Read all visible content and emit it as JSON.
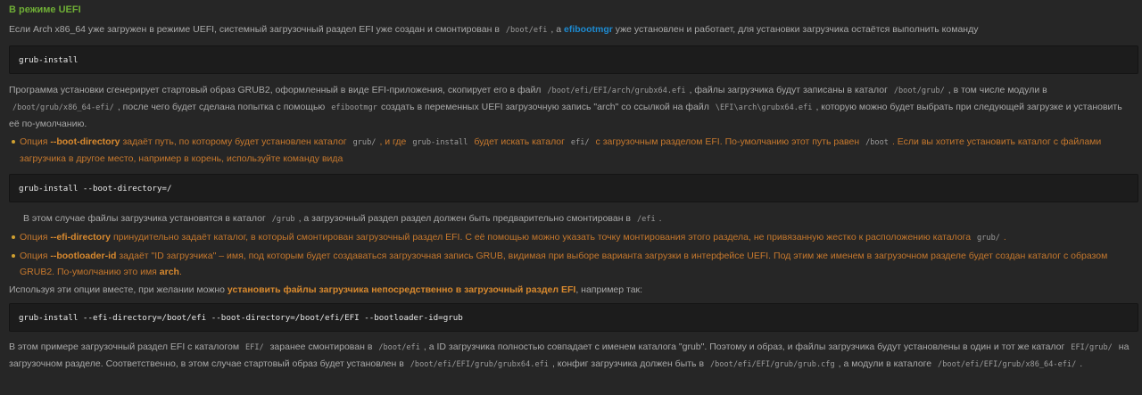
{
  "section_title": "В режиме UEFI",
  "p1": {
    "t1": "Если Arch x86_64 уже загружен в режиме UEFI, системный загрузочный раздел EFI уже создан и смонтирован в",
    "c1": "/boot/efi",
    "t2": ", а",
    "link": "efibootmgr",
    "t3": "уже установлен и работает, для установки загрузчика остаётся выполнить команду"
  },
  "code1": "grub-install",
  "p2": {
    "t1": "Программа установки сгенерирует стартовый образ GRUB2, оформленный в виде EFI-приложения, скопирует его в файл",
    "c1": "/boot/efi/EFI/arch/grubx64.efi",
    "t2": ", файлы загрузчика будут записаны в каталог",
    "c2": "/boot/grub/",
    "t3": ", в том числе модули в",
    "c3": "/boot/grub/x86_64-efi/",
    "t4": ", после чего будет сделана попытка с помощью",
    "c4": "efibootmgr",
    "t5": "создать в переменных UEFI загрузочную запись \"arch\" со ссылкой на файл",
    "c5": "\\EFI\\arch\\grubx64.efi",
    "t6": ", которую можно будет выбрать при следующей загрузке и установить её по-умолчанию."
  },
  "bullet1": {
    "t1": "Опция",
    "b1": "--boot-directory",
    "t2": "задаёт путь, по которому будет установлен каталог",
    "c1": "grub/",
    "t3": ", и где",
    "c2": "grub-install",
    "t4": "будет искать каталог",
    "c3": "efi/",
    "t5": "с загрузочным разделом EFI. По-умолчанию этот путь равен",
    "c4": "/boot",
    "t6": ". Если вы хотите установить каталог с файлами загрузчика в другое место, например в корень, используйте команду вида"
  },
  "code2": "grub-install --boot-directory=/",
  "p3": {
    "t1": "В этом случае файлы загрузчика установятся в каталог",
    "c1": "/grub",
    "t2": ", а загрузочный раздел раздел должен быть предварительно смонтирован в",
    "c2": "/efi",
    "t3": "."
  },
  "bullet2": {
    "t1": "Опция",
    "b1": "--efi-directory",
    "t2": "принудительно задаёт каталог, в который смонтирован загрузочный раздел EFI. С её помощью можно указать точку монтирования этого раздела, не привязанную жестко к расположению каталога",
    "c1": "grub/",
    "t3": "."
  },
  "bullet3": {
    "t1": "Опция",
    "b1": "--bootloader-id",
    "t2": "задаёт \"ID загрузчика\" – имя, под которым будет создаваться загрузочная запись GRUB, видимая при выборе варианта загрузки в интерфейсе UEFI. Под этим же именем в загрузочном разделе будет создан каталог с образом GRUB2. По-умолчанию это имя",
    "b2": "arch",
    "t3": "."
  },
  "p4": {
    "t1": "Используя эти опции вместе, при желании можно",
    "b1": "установить файлы загрузчика непосредственно в загрузочный раздел EFI",
    "t2": ", например так:"
  },
  "code3": "grub-install --efi-directory=/boot/efi --boot-directory=/boot/efi/EFI --bootloader-id=grub",
  "p5": {
    "t1": "В этом примере загрузочный раздел EFI с каталогом",
    "c1": "EFI/",
    "t2": "заранее смонтирован в",
    "c2": "/boot/efi",
    "t3": ", а ID загрузчика полностью совпадает с именем каталога \"grub\". Поэтому и образ, и файлы загрузчика будут установлены в один и тот же каталог",
    "c3": "EFI/grub/",
    "t4": "на загрузочном разделе. Соответственно, в этом случае стартовый образ будет установлен в",
    "c4": "/boot/efi/EFI/grub/grubx64.efi",
    "t5": ", конфиг загрузчика должен быть в",
    "c5": "/boot/efi/EFI/grub/grub.cfg",
    "t6": ", а модули в каталоге",
    "c6": "/boot/efi/EFI/grub/x86_64-efi/",
    "t7": "."
  }
}
